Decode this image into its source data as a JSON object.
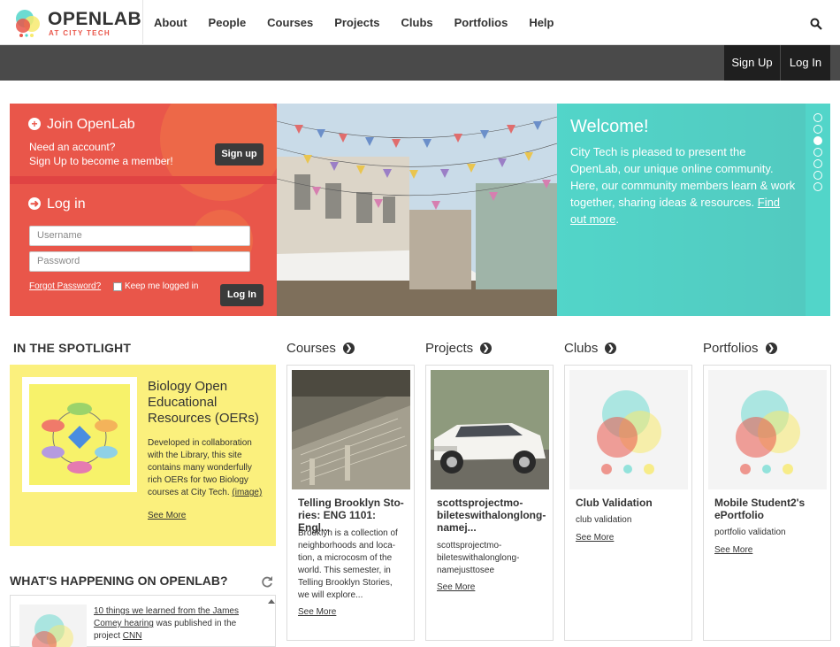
{
  "brand": {
    "name": "OPENLAB",
    "subtitle": "AT CITY TECH"
  },
  "nav": {
    "items": [
      "About",
      "People",
      "Courses",
      "Projects",
      "Clubs",
      "Portfolios",
      "Help"
    ]
  },
  "account_bar": {
    "signup": "Sign Up",
    "login": "Log In"
  },
  "join": {
    "title": "Join OpenLab",
    "line1": "Need an account?",
    "line2": "Sign Up to become a member!",
    "signup_button": "Sign up"
  },
  "login": {
    "title": "Log in",
    "username_placeholder": "Username",
    "password_placeholder": "Password",
    "forgot": "Forgot Password?",
    "keep": "Keep me logged in",
    "button": "Log In"
  },
  "welcome": {
    "title": "Welcome!",
    "text": "City Tech is pleased to present the OpenLab, our unique online community. Here, our community members learn & work together, sharing ideas & resources.",
    "link": "Find out more",
    "slides": 7,
    "active_slide": 3
  },
  "spotlight": {
    "heading": "IN THE SPOTLIGHT",
    "title": "Biology Open Educational Resources (OERs)",
    "desc": "Developed in collaboration with the Library, this site contains many wonderfully rich OERs for two Biology courses at City Tech.",
    "desc_link": "(image)",
    "more": "See More"
  },
  "happening": {
    "heading": "WHAT'S HAPPENING ON OPENLAB?",
    "item_link": "10 things we learned from the James Comey hearing",
    "item_mid": " was published in the project ",
    "item_project": "CNN"
  },
  "columns": [
    {
      "heading": "Courses",
      "title": "Telling Brooklyn Sto­ries: ENG 1101: Engl...",
      "desc": "Brooklyn is a collection of neighborhoods and loca­tion, a microcosm of the world. This semester, in Telling Brooklyn Stories, we will explore...",
      "more": "See More"
    },
    {
      "heading": "Projects",
      "title": "scottsprojectmo­bileteswithalonglong­namej...",
      "desc": "scottsprojectmo­bileteswithalonglong­namejusttosee",
      "more": "See More"
    },
    {
      "heading": "Clubs",
      "title": "Club Validation",
      "desc": "club validation",
      "more": "See More"
    },
    {
      "heading": "Portfolios",
      "title": "Mobile Student2's ePortfolio",
      "desc": "portfolio validation",
      "more": "See More"
    }
  ],
  "colors": {
    "coral": "#e9564a",
    "teal": "#52d5c9",
    "yellow": "#fbf07d",
    "dark": "#1f1f1f"
  }
}
